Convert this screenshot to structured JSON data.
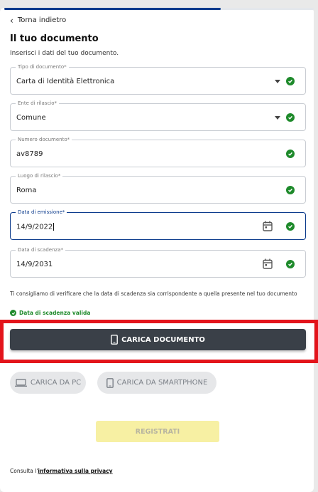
{
  "progress": {
    "fraction": 0.7
  },
  "nav": {
    "back_label": "Torna indietro",
    "back_icon": "chevron-left-icon"
  },
  "page": {
    "title": "Il tuo documento",
    "subtitle": "Inserisci i dati del tuo documento."
  },
  "fields": {
    "document_type": {
      "label": "Tipo di documento*",
      "value": "Carta di Identità Elettronica"
    },
    "issuer": {
      "label": "Ente di rilascio*",
      "value": "Comune"
    },
    "document_number": {
      "label": "Numero documento*",
      "value": "av8789"
    },
    "issue_place": {
      "label": "Luogo di rilascio*",
      "value": "Roma"
    },
    "issue_date": {
      "label": "Data di emissione*",
      "value": "14/9/2022"
    },
    "expiry_date": {
      "label": "Data di scadenza*",
      "value": "14/9/2031"
    }
  },
  "hint": "Ti consigliamo di verificare che la data di scadenza sia corrispondente a quella presente nel tuo documento",
  "validation": {
    "message": "Data di scadenza valida"
  },
  "buttons": {
    "upload_document": "CARICA DOCUMENTO",
    "upload_from_pc": "CARICA DA PC",
    "upload_from_smartphone": "CARICA DA SMARTPHONE",
    "register": "REGISTRATI"
  },
  "footer": {
    "prefix": "Consulta l'",
    "link": "informativa sulla privacy"
  },
  "colors": {
    "brand_blue": "#0b3a8c",
    "success_green": "#1e8a2b",
    "dark_button": "#3a4048",
    "highlight_red": "#e3141b",
    "register_disabled": "#f7f0a3"
  }
}
